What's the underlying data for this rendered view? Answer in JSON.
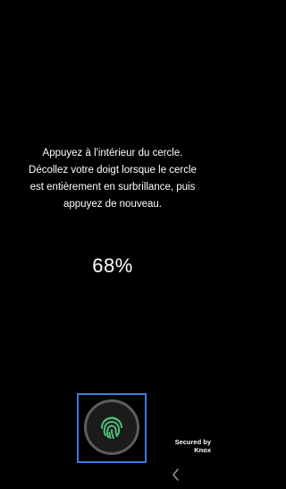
{
  "instructions": {
    "line1": "Appuyez à l'intérieur du cercle.",
    "line2": "Décollez votre doigt lorsque le cercle",
    "line3": "est entièrement en surbrillance, puis",
    "line4": "appuyez de nouveau."
  },
  "progress": {
    "text": "68%",
    "value": 68
  },
  "scanner": {
    "icon": "fingerprint-icon",
    "icon_color": "#4fbf7a",
    "frame_color": "#3f7ae0"
  },
  "badge": {
    "line1": "Secured by",
    "line2": "Knox"
  },
  "nav": {
    "back_icon": "chevron-left-icon"
  }
}
